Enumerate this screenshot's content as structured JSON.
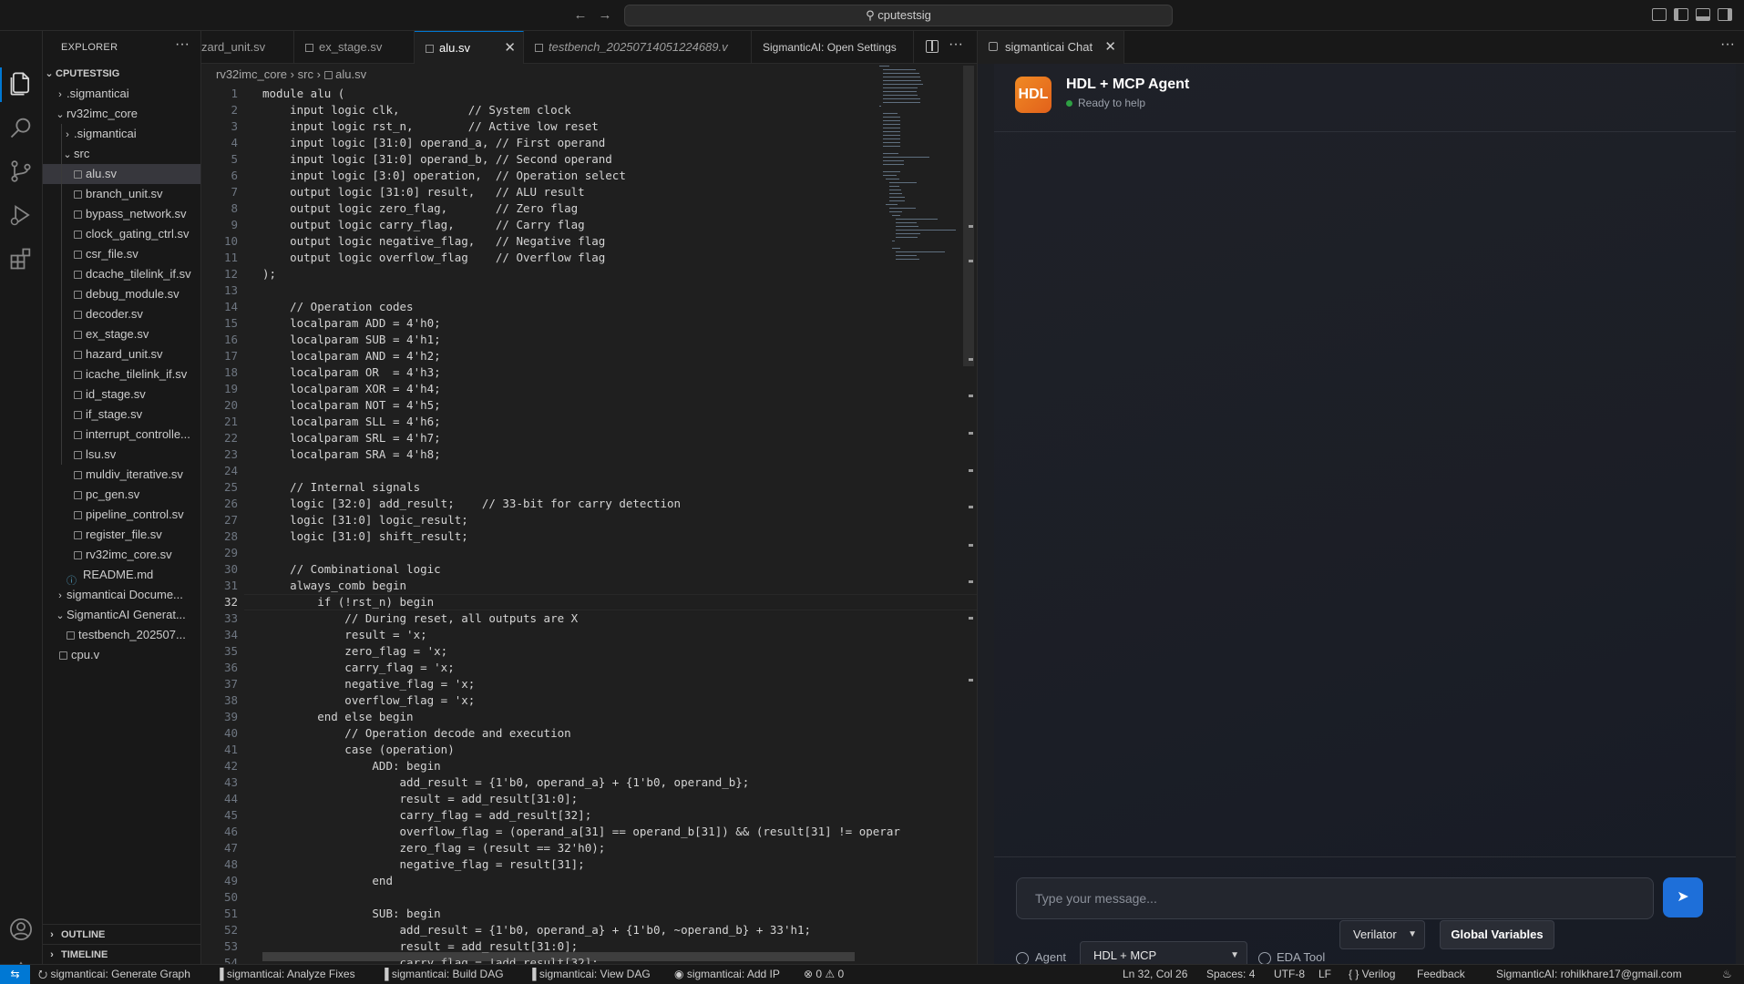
{
  "titlebar": {
    "search_text": "cputestsig"
  },
  "sidebar": {
    "title": "EXPLORER",
    "more": "···",
    "root": "CPUTESTSIG",
    "tree": [
      {
        "label": ".sigmanticai",
        "indent": 1,
        "chev": "›",
        "type": "folder"
      },
      {
        "label": "rv32imc_core",
        "indent": 1,
        "chev": "⌄",
        "type": "folder"
      },
      {
        "label": ".sigmanticai",
        "indent": 2,
        "chev": "›",
        "type": "folder"
      },
      {
        "label": "src",
        "indent": 2,
        "chev": "⌄",
        "type": "folder"
      },
      {
        "label": "alu.sv",
        "indent": 3,
        "type": "sv",
        "selected": true
      },
      {
        "label": "branch_unit.sv",
        "indent": 3,
        "type": "sv"
      },
      {
        "label": "bypass_network.sv",
        "indent": 3,
        "type": "sv"
      },
      {
        "label": "clock_gating_ctrl.sv",
        "indent": 3,
        "type": "sv"
      },
      {
        "label": "csr_file.sv",
        "indent": 3,
        "type": "sv"
      },
      {
        "label": "dcache_tilelink_if.sv",
        "indent": 3,
        "type": "sv"
      },
      {
        "label": "debug_module.sv",
        "indent": 3,
        "type": "sv"
      },
      {
        "label": "decoder.sv",
        "indent": 3,
        "type": "sv"
      },
      {
        "label": "ex_stage.sv",
        "indent": 3,
        "type": "sv"
      },
      {
        "label": "hazard_unit.sv",
        "indent": 3,
        "type": "sv"
      },
      {
        "label": "icache_tilelink_if.sv",
        "indent": 3,
        "type": "sv"
      },
      {
        "label": "id_stage.sv",
        "indent": 3,
        "type": "sv"
      },
      {
        "label": "if_stage.sv",
        "indent": 3,
        "type": "sv"
      },
      {
        "label": "interrupt_controlle...",
        "indent": 3,
        "type": "sv"
      },
      {
        "label": "lsu.sv",
        "indent": 3,
        "type": "sv"
      },
      {
        "label": "muldiv_iterative.sv",
        "indent": 3,
        "type": "sv"
      },
      {
        "label": "pc_gen.sv",
        "indent": 3,
        "type": "sv"
      },
      {
        "label": "pipeline_control.sv",
        "indent": 3,
        "type": "sv"
      },
      {
        "label": "register_file.sv",
        "indent": 3,
        "type": "sv"
      },
      {
        "label": "rv32imc_core.sv",
        "indent": 3,
        "type": "sv"
      },
      {
        "label": "README.md",
        "indent": 2,
        "type": "md"
      },
      {
        "label": "sigmanticai Docume...",
        "indent": 1,
        "chev": "›",
        "type": "folder"
      },
      {
        "label": "SigmanticAI Generat...",
        "indent": 1,
        "chev": "⌄",
        "type": "folder"
      },
      {
        "label": "testbench_202507...",
        "indent": 2,
        "type": "sv"
      },
      {
        "label": "cpu.v",
        "indent": 1,
        "type": "sv"
      }
    ],
    "outline": "OUTLINE",
    "timeline": "TIMELINE"
  },
  "editor": {
    "tabs": [
      {
        "label": "zard_unit.sv",
        "active": false
      },
      {
        "label": "ex_stage.sv",
        "active": false
      },
      {
        "label": "alu.sv",
        "active": true
      },
      {
        "label": "testbench_20250714051224689.v",
        "active": false,
        "italic": true
      },
      {
        "label": "SigmanticAI: Open Settings",
        "active": false
      }
    ],
    "breadcrumb": [
      "rv32imc_core",
      "src",
      "alu.sv"
    ],
    "current_line": 32,
    "lines": [
      "module alu (",
      "    input logic clk,          // System clock",
      "    input logic rst_n,        // Active low reset",
      "    input logic [31:0] operand_a, // First operand",
      "    input logic [31:0] operand_b, // Second operand",
      "    input logic [3:0] operation,  // Operation select",
      "    output logic [31:0] result,   // ALU result",
      "    output logic zero_flag,       // Zero flag",
      "    output logic carry_flag,      // Carry flag",
      "    output logic negative_flag,   // Negative flag",
      "    output logic overflow_flag    // Overflow flag",
      ");",
      "",
      "    // Operation codes",
      "    localparam ADD = 4'h0;",
      "    localparam SUB = 4'h1;",
      "    localparam AND = 4'h2;",
      "    localparam OR  = 4'h3;",
      "    localparam XOR = 4'h4;",
      "    localparam NOT = 4'h5;",
      "    localparam SLL = 4'h6;",
      "    localparam SRL = 4'h7;",
      "    localparam SRA = 4'h8;",
      "",
      "    // Internal signals",
      "    logic [32:0] add_result;    // 33-bit for carry detection",
      "    logic [31:0] logic_result;",
      "    logic [31:0] shift_result;",
      "",
      "    // Combinational logic",
      "    always_comb begin",
      "        if (!rst_n) begin",
      "            // During reset, all outputs are X",
      "            result = 'x;",
      "            zero_flag = 'x;",
      "            carry_flag = 'x;",
      "            negative_flag = 'x;",
      "            overflow_flag = 'x;",
      "        end else begin",
      "            // Operation decode and execution",
      "            case (operation)",
      "                ADD: begin",
      "                    add_result = {1'b0, operand_a} + {1'b0, operand_b};",
      "                    result = add_result[31:0];",
      "                    carry_flag = add_result[32];",
      "                    overflow_flag = (operand_a[31] == operand_b[31]) && (result[31] != operar",
      "                    zero_flag = (result == 32'h0);",
      "                    negative_flag = result[31];",
      "                end",
      "",
      "                SUB: begin",
      "                    add_result = {1'b0, operand_a} + {1'b0, ~operand_b} + 33'h1;",
      "                    result = add_result[31:0];",
      "                    carry_flag = !add_result[32];"
    ]
  },
  "chat": {
    "tab_label": "sigmanticai Chat",
    "logo_text": "HDL",
    "agent_name": "HDL + MCP Agent",
    "agent_status": "Ready to help",
    "input_placeholder": "Type your message...",
    "send_label": "➤",
    "agent_label": "Agent",
    "agent_value": "HDL + MCP",
    "eda_label": "EDA Tool",
    "eda_value": "Verilator",
    "global_vars": "Global Variables"
  },
  "statusbar": {
    "items_left": [
      "sigmanticai: Generate Graph",
      "sigmanticai: Analyze Fixes",
      "sigmanticai: Build DAG",
      "sigmanticai: View DAG",
      "sigmanticai: Add IP",
      "⊗ 0 ⚠ 0"
    ],
    "items_right": [
      "Ln 32, Col 26",
      "Spaces: 4",
      "UTF-8",
      "LF",
      "{ } Verilog",
      "Feedback",
      "SigmanticAI: rohilkhare17@gmail.com"
    ]
  }
}
